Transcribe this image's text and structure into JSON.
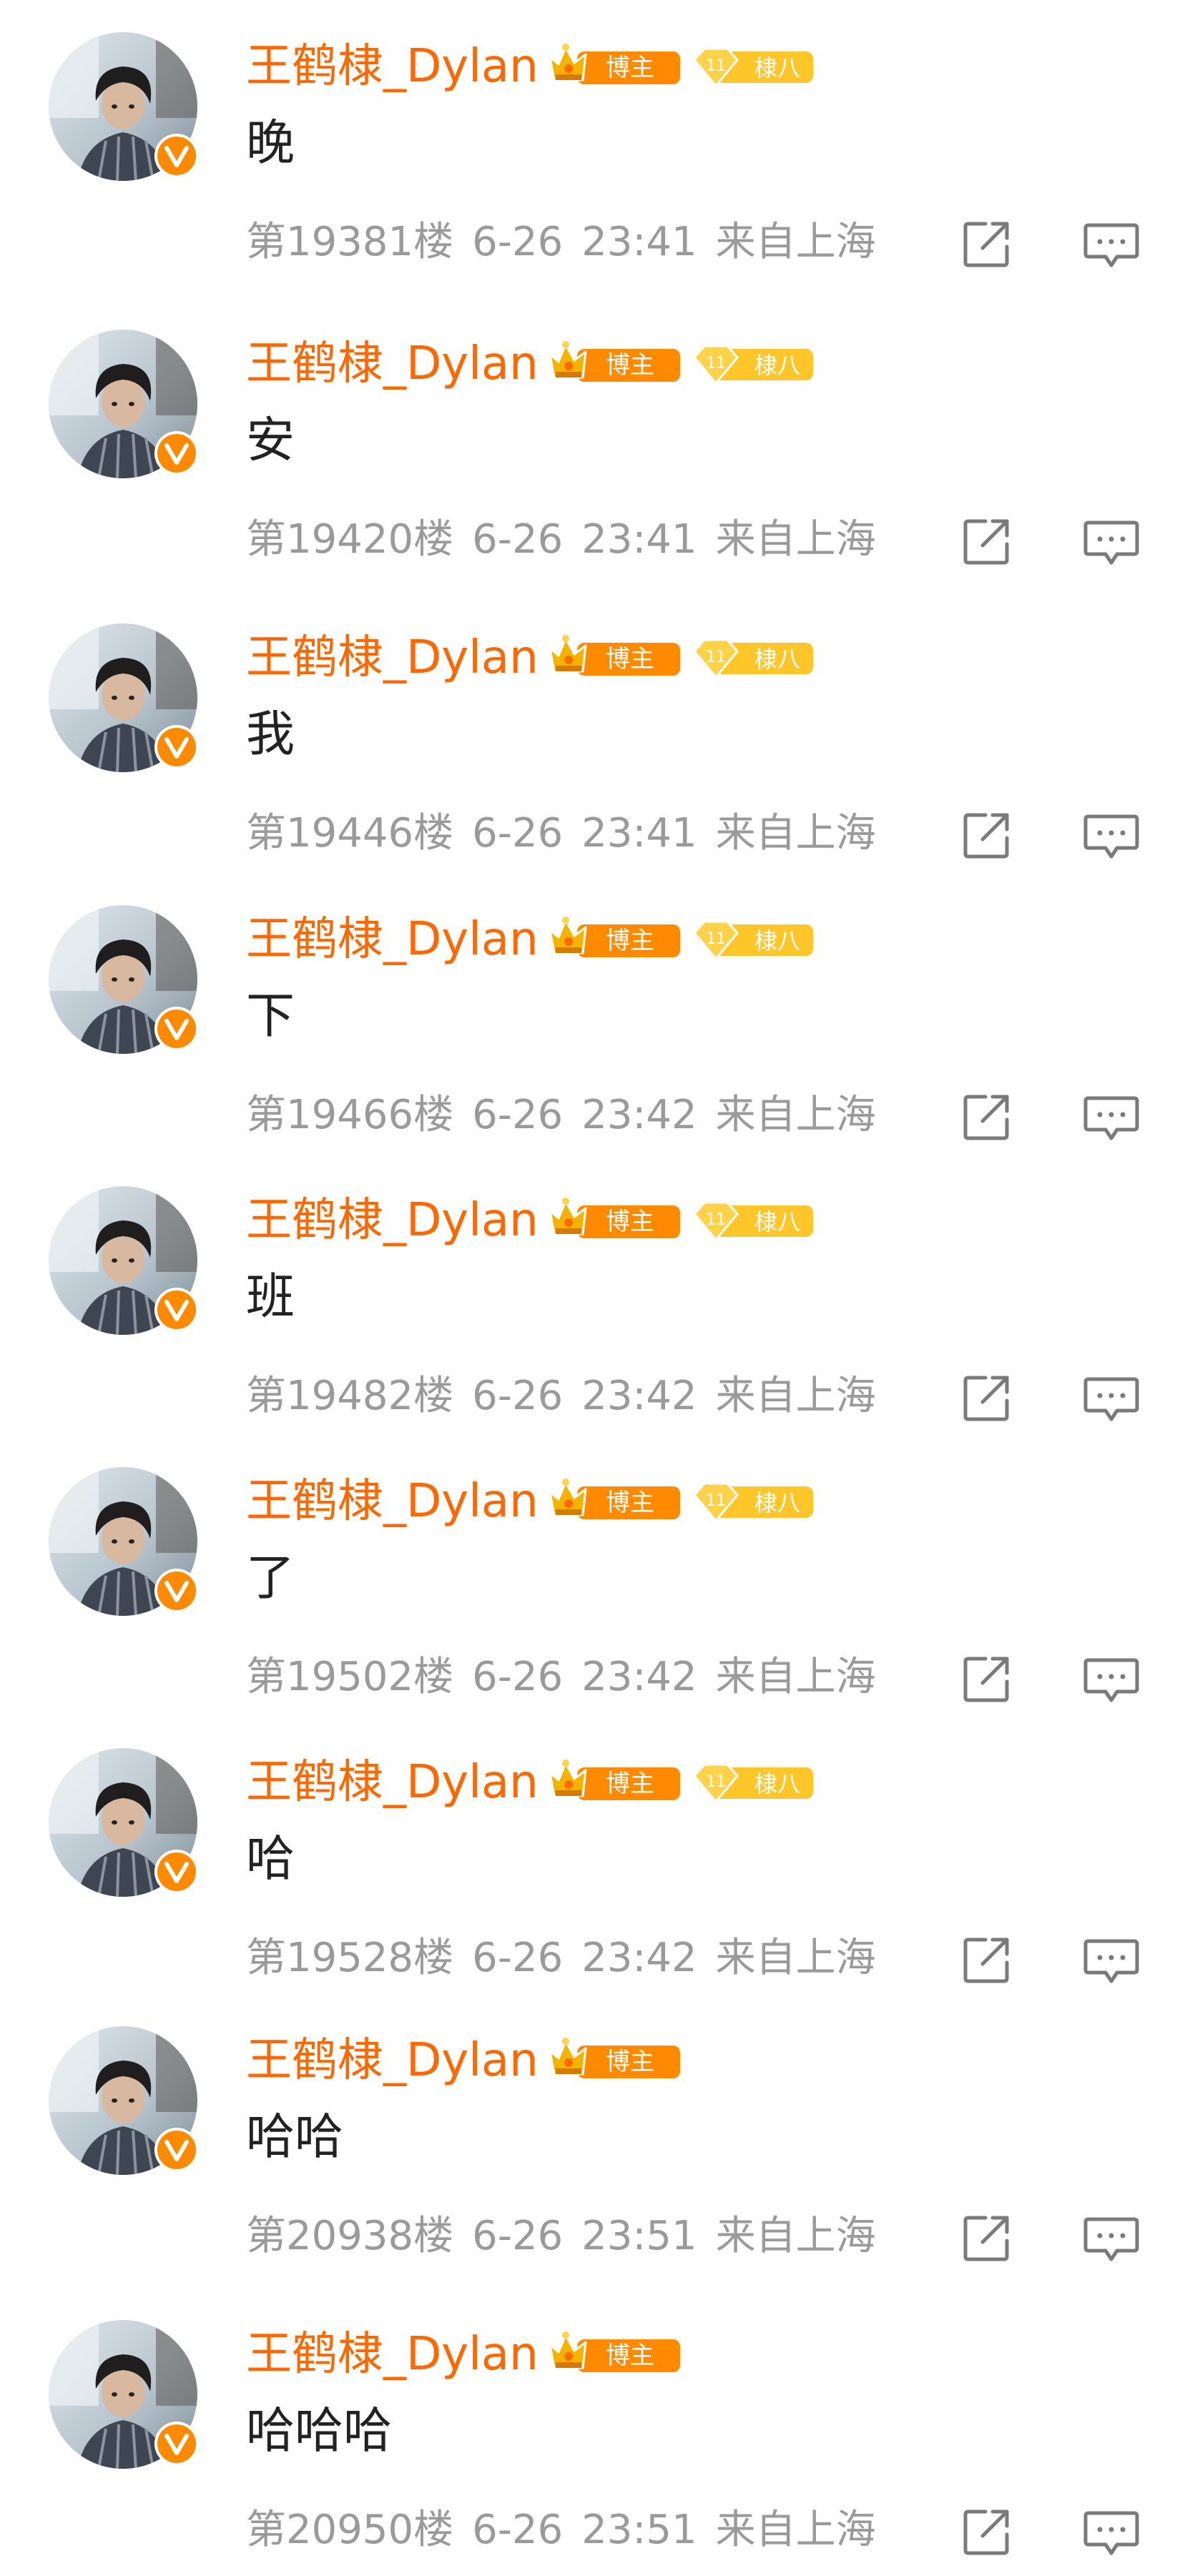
{
  "comments": [
    {
      "username": "王鹤棣_Dylan",
      "host_badge": "博主",
      "level_badge": {
        "level": "11",
        "label": "棣八"
      },
      "content": "晚",
      "floor": "第19381楼",
      "date": "6-26",
      "time": "23:41",
      "location": "来自上海"
    },
    {
      "username": "王鹤棣_Dylan",
      "host_badge": "博主",
      "level_badge": {
        "level": "11",
        "label": "棣八"
      },
      "content": "安",
      "floor": "第19420楼",
      "date": "6-26",
      "time": "23:41",
      "location": "来自上海"
    },
    {
      "username": "王鹤棣_Dylan",
      "host_badge": "博主",
      "level_badge": {
        "level": "11",
        "label": "棣八"
      },
      "content": "我",
      "floor": "第19446楼",
      "date": "6-26",
      "time": "23:41",
      "location": "来自上海"
    },
    {
      "username": "王鹤棣_Dylan",
      "host_badge": "博主",
      "level_badge": {
        "level": "11",
        "label": "棣八"
      },
      "content": "下",
      "floor": "第19466楼",
      "date": "6-26",
      "time": "23:42",
      "location": "来自上海"
    },
    {
      "username": "王鹤棣_Dylan",
      "host_badge": "博主",
      "level_badge": {
        "level": "11",
        "label": "棣八"
      },
      "content": "班",
      "floor": "第19482楼",
      "date": "6-26",
      "time": "23:42",
      "location": "来自上海"
    },
    {
      "username": "王鹤棣_Dylan",
      "host_badge": "博主",
      "level_badge": {
        "level": "11",
        "label": "棣八"
      },
      "content": "了",
      "floor": "第19502楼",
      "date": "6-26",
      "time": "23:42",
      "location": "来自上海"
    },
    {
      "username": "王鹤棣_Dylan",
      "host_badge": "博主",
      "level_badge": {
        "level": "11",
        "label": "棣八"
      },
      "content": "哈",
      "floor": "第19528楼",
      "date": "6-26",
      "time": "23:42",
      "location": "来自上海"
    },
    {
      "username": "王鹤棣_Dylan",
      "host_badge": "博主",
      "level_badge": null,
      "content": "哈哈",
      "floor": "第20938楼",
      "date": "6-26",
      "time": "23:51",
      "location": "来自上海"
    },
    {
      "username": "王鹤棣_Dylan",
      "host_badge": "博主",
      "level_badge": null,
      "content": "哈哈哈",
      "floor": "第20950楼",
      "date": "6-26",
      "time": "23:51",
      "location": "来自上海"
    }
  ],
  "icons": {
    "crown": "crown-icon",
    "diamond": "diamond-icon",
    "verified": "verified-v-icon",
    "share": "share-icon",
    "reply": "comment-icon"
  },
  "colors": {
    "username": "#ff6700",
    "meta": "#9a9a9a",
    "content": "#222222",
    "host_badge": "#ff8a00",
    "level_badge": "#ffc629",
    "verified": "#ff8a00",
    "icon": "#7a7a7a"
  }
}
